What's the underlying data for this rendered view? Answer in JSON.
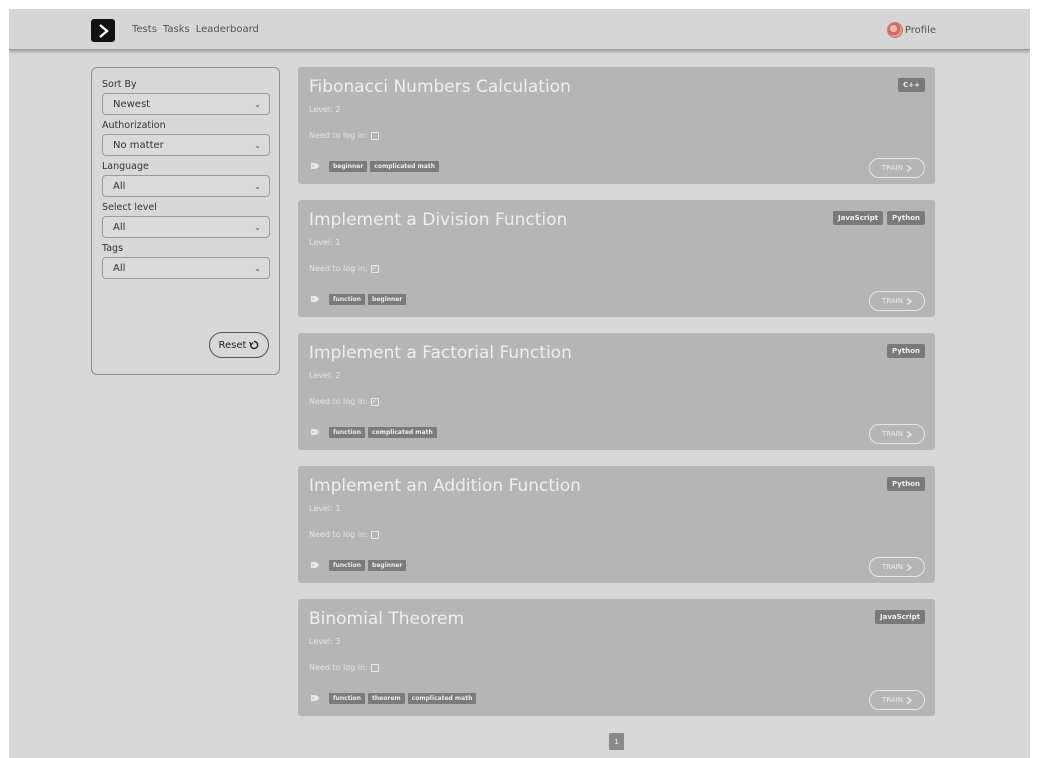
{
  "nav": {
    "links": [
      "Tests",
      "Tasks",
      "Leaderboard"
    ],
    "profile_label": "Profile"
  },
  "filters": {
    "sort_by": {
      "label": "Sort By",
      "value": "Newest"
    },
    "authorization": {
      "label": "Authorization",
      "value": "No matter"
    },
    "language": {
      "label": "Language",
      "value": "All"
    },
    "level": {
      "label": "Select level",
      "value": "All"
    },
    "tags": {
      "label": "Tags",
      "value": "All"
    },
    "reset_label": "Reset"
  },
  "tasks": [
    {
      "title": "Fibonacci Numbers Calculation",
      "level": "Level: 2",
      "login_label": "Need to log in:",
      "login_required": false,
      "tags": [
        "beginner",
        "complicated math"
      ],
      "languages": [
        "C++"
      ],
      "train_label": "TRAIN"
    },
    {
      "title": "Implement a Division Function",
      "level": "Level: 1",
      "login_label": "Need to log in:",
      "login_required": true,
      "tags": [
        "function",
        "beginner"
      ],
      "languages": [
        "JavaScript",
        "Python"
      ],
      "train_label": "TRAIN"
    },
    {
      "title": "Implement a Factorial Function",
      "level": "Level: 2",
      "login_label": "Need to log in:",
      "login_required": true,
      "tags": [
        "function",
        "complicated math"
      ],
      "languages": [
        "Python"
      ],
      "train_label": "TRAIN"
    },
    {
      "title": "Implement an Addition Function",
      "level": "Level: 1",
      "login_label": "Need to log in:",
      "login_required": false,
      "tags": [
        "function",
        "beginner"
      ],
      "languages": [
        "Python"
      ],
      "train_label": "TRAIN"
    },
    {
      "title": "Binomial Theorem",
      "level": "Level: 3",
      "login_label": "Need to log in:",
      "login_required": false,
      "tags": [
        "function",
        "theorem",
        "complicated math"
      ],
      "languages": [
        "JavaScript"
      ],
      "train_label": "TRAIN"
    }
  ],
  "pagination": {
    "current_page": "1"
  }
}
